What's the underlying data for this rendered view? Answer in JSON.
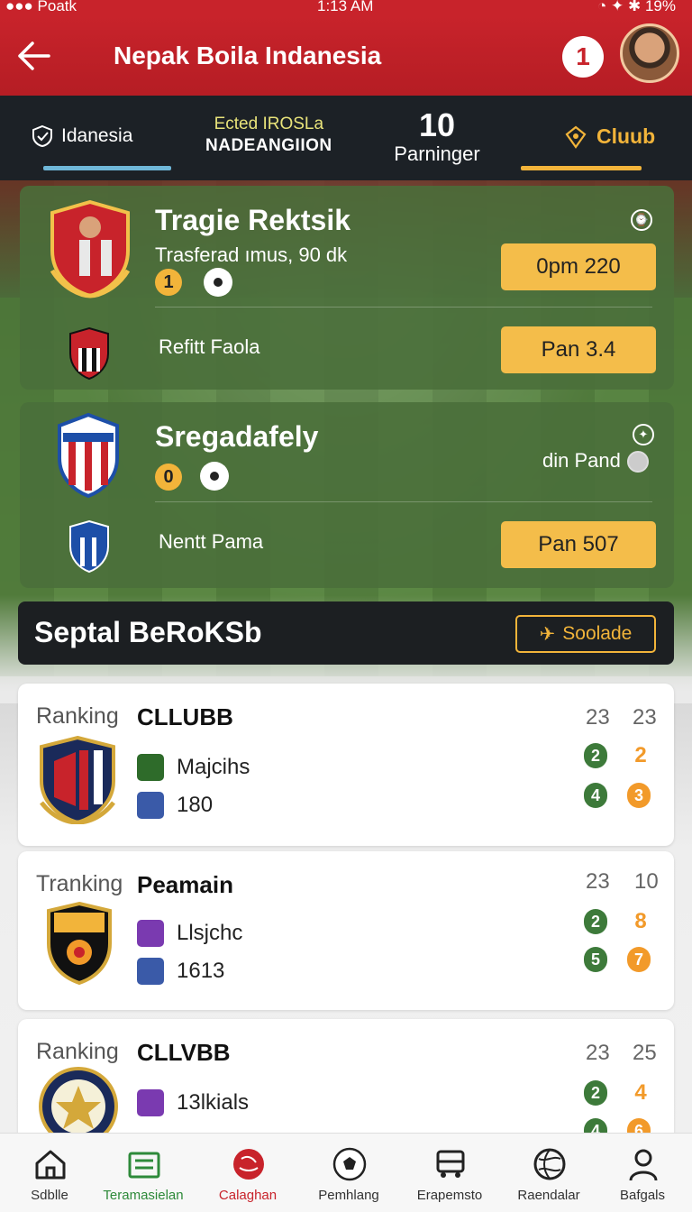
{
  "status_bar": {
    "carrier": "●●● Poatk",
    "time": "1:13 AM",
    "battery": "19%"
  },
  "header": {
    "title": "Nepak Boila Indanesia",
    "notification_count": "1"
  },
  "tabs": {
    "indonesia": "Idanesia",
    "mid_line1": "Ected IROSLa",
    "mid_line2": "NADEANGIION",
    "count_num": "10",
    "count_label": "Parninger",
    "club": "Cluub"
  },
  "matches": [
    {
      "home": "Tragie Rektsik",
      "home_sub": "Trasferad ımus, 90 dk",
      "home_score": "1",
      "away": "Refitt Faola",
      "odds_home": "0pm 220",
      "odds_away": "Pan 3.4"
    },
    {
      "home": "Sregadafely",
      "home_score": "0",
      "side_note": "din Pand",
      "away": "Nentt Pama",
      "odds_away": "Pan 507"
    }
  ],
  "section": {
    "title": "Septal BeRoKSb",
    "button": "Soolade"
  },
  "rankings": [
    {
      "label": "Ranking",
      "club": "CLLUBB",
      "stat1": "Majcihs",
      "stat2": "180",
      "h1": "23",
      "h2": "23",
      "a1": "2",
      "a2": "2",
      "b1": "4",
      "b2": "3"
    },
    {
      "label": "Tranking",
      "club": "Peamain",
      "stat1": "Llsjchc",
      "stat2": "1613",
      "h1": "23",
      "h2": "10",
      "a1": "2",
      "a2": "8",
      "b1": "5",
      "b2": "7"
    },
    {
      "label": "Ranking",
      "club": "CLLVBB",
      "stat1": "13lkials",
      "stat2": "",
      "h1": "23",
      "h2": "25",
      "a1": "2",
      "a2": "4",
      "b1": "4",
      "b2": "6"
    }
  ],
  "nav": [
    {
      "label": "Sdblle",
      "icon": "home-icon"
    },
    {
      "label": "Teramasielan",
      "icon": "list-icon"
    },
    {
      "label": "Calaghan",
      "icon": "ball-red-icon"
    },
    {
      "label": "Pemhlang",
      "icon": "soccer-ball-icon"
    },
    {
      "label": "Erapemsto",
      "icon": "bus-icon"
    },
    {
      "label": "Raendalar",
      "icon": "globe-icon"
    },
    {
      "label": "Bafgals",
      "icon": "user-icon"
    }
  ],
  "colors": {
    "brand_red": "#c8232b",
    "accent_gold": "#f2b43a",
    "card_green": "#4a6e3a"
  }
}
